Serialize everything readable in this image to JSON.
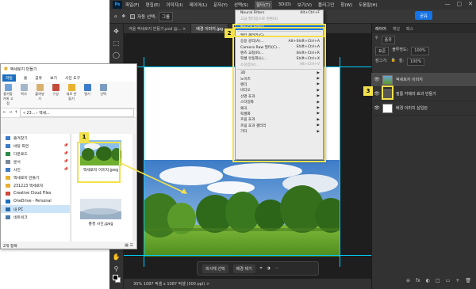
{
  "photoshop": {
    "menu": [
      "파일(F)",
      "편집(E)",
      "이미지(I)",
      "레이어(L)",
      "문자(Y)",
      "선택(S)",
      "필터(T)",
      "3D(D)",
      "보기(V)",
      "플러그인",
      "창(W)",
      "도움말(H)"
    ],
    "active_menu_index": 6,
    "window_controls": [
      "—",
      "▢",
      "✕"
    ],
    "options": {
      "auto_select_label": "자동 선택:",
      "auto_select_value": "그룹",
      "share_label": "공유"
    },
    "tabs": [
      "겨울 액세로지 만들기.psd @...",
      "배경 이미지.jpg"
    ],
    "tab_close": "×",
    "filter_menu": {
      "items": [
        {
          "label": "Neural Filters",
          "shortcut": "Alt+Ctrl+F",
          "state": "normal",
          "arrow": false
        },
        {
          "label": "고급 필터용으로 변환(S)",
          "shortcut": "",
          "state": "disabled",
          "arrow": false
        },
        {
          "label": "Neural Filters...",
          "shortcut": "",
          "state": "highlighted",
          "arrow": false
        },
        {
          "label": "필터 갤러리(G)...",
          "shortcut": "",
          "state": "normal",
          "arrow": false
        },
        {
          "label": "응용 광각(A)...",
          "shortcut": "Alt+Shift+Ctrl+A",
          "state": "normal",
          "arrow": false
        },
        {
          "label": "Camera Raw 필터(C)...",
          "shortcut": "Shift+Ctrl+A",
          "state": "normal",
          "arrow": false
        },
        {
          "label": "렌즈 교정(R)...",
          "shortcut": "Shift+Ctrl+R",
          "state": "normal",
          "arrow": false
        },
        {
          "label": "픽셀 유동화(L)...",
          "shortcut": "Shift+Ctrl+X",
          "state": "normal",
          "arrow": false
        },
        {
          "label": "소실점(V)...",
          "shortcut": "Alt+Ctrl+V",
          "state": "disabled",
          "arrow": false
        },
        {
          "label": "3D",
          "shortcut": "",
          "state": "normal",
          "arrow": true
        },
        {
          "label": "노이즈",
          "shortcut": "",
          "state": "normal",
          "arrow": true
        },
        {
          "label": "렌더",
          "shortcut": "",
          "state": "normal",
          "arrow": true
        },
        {
          "label": "비디오",
          "shortcut": "",
          "state": "normal",
          "arrow": true
        },
        {
          "label": "선명 효과",
          "shortcut": "",
          "state": "normal",
          "arrow": true
        },
        {
          "label": "스타일화",
          "shortcut": "",
          "state": "normal",
          "arrow": true
        },
        {
          "label": "왜곡",
          "shortcut": "",
          "state": "normal",
          "arrow": true
        },
        {
          "label": "픽셀화",
          "shortcut": "",
          "state": "normal",
          "arrow": true
        },
        {
          "label": "흐림 효과",
          "shortcut": "",
          "state": "normal",
          "arrow": true
        },
        {
          "label": "흐림 효과 갤러리",
          "shortcut": "",
          "state": "normal",
          "arrow": true
        },
        {
          "label": "기타",
          "shortcut": "",
          "state": "normal",
          "arrow": true
        }
      ]
    },
    "context_bar": {
      "select_subject": "피사체 선택",
      "remove_bg": "배경 제거",
      "more": "···"
    },
    "status": "30%   1087 픽셀 x 1087 픽셀 (300 ppi)   >",
    "panels": {
      "tabs": [
        "레이어",
        "채널",
        "패스"
      ],
      "search_placeholder": "종류",
      "blend_mode": "표준",
      "opacity_label": "불투명도:",
      "opacity_value": "100%",
      "lock_label": "잠그기:",
      "fill_label": "칠:",
      "fill_value": "100%",
      "layers": [
        {
          "name": "액세로지 이미지"
        },
        {
          "name": "필름 카메라 효과 만들기"
        },
        {
          "name": "배경 이미지 삽입란"
        }
      ]
    },
    "icons": {
      "eye": "👁",
      "bottom": [
        "⊖",
        "fx",
        "◐",
        "□",
        "▭",
        "+",
        "🗑"
      ]
    }
  },
  "explorer": {
    "title": "액세로지 만들기",
    "tabs": [
      "파일",
      "홈",
      "공유",
      "보기",
      "사진 도구"
    ],
    "manage_label": "관리",
    "ribbon": [
      "즐겨찾기에 고정",
      "복사",
      "붙여넣기",
      "구성",
      "새로 만들기",
      "열기",
      "선택"
    ],
    "clipboard_label": "클립보드",
    "address": "« 23... › 액세...",
    "nav_items": [
      {
        "label": "즐겨찾기",
        "pin": false,
        "sel": false
      },
      {
        "label": "바탕 화면",
        "pin": true,
        "sel": false
      },
      {
        "label": "다운로드",
        "pin": true,
        "sel": false
      },
      {
        "label": "문서",
        "pin": true,
        "sel": false
      },
      {
        "label": "사진",
        "pin": true,
        "sel": false
      },
      {
        "label": "액세로지 만들기",
        "pin": false,
        "sel": false
      },
      {
        "label": "231223 액세로지",
        "pin": false,
        "sel": false
      },
      {
        "label": "Creative Cloud Files",
        "pin": false,
        "sel": false
      },
      {
        "label": "OneDrive - Personal",
        "pin": false,
        "sel": false
      },
      {
        "label": "내 PC",
        "pin": false,
        "sel": true
      },
      {
        "label": "네트워크",
        "pin": false,
        "sel": false
      }
    ],
    "pin_glyph": "📌",
    "files": [
      {
        "name": "액세로지 이미지.jpeg"
      },
      {
        "name": "풍경 사진.jpeg"
      }
    ],
    "status": "2개 항목"
  },
  "callouts": [
    "1",
    "2",
    "3"
  ],
  "colors": {
    "highlight": "#f2e14a",
    "menu_selected": "#1473e6",
    "ps_bg": "#2b2b2b",
    "guide": "#00d0ff"
  }
}
